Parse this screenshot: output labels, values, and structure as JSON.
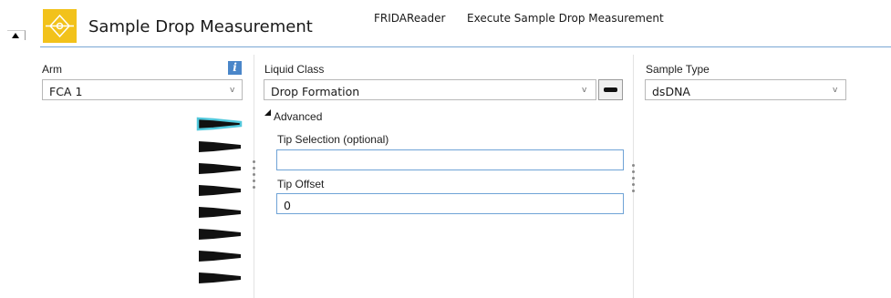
{
  "header": {
    "title": "Sample Drop Measurement",
    "app_name": "FRIDAReader",
    "action": "Execute Sample Drop Measurement",
    "icon": "drop-target-icon",
    "accent_color": "#f2c21b"
  },
  "arm": {
    "label": "Arm",
    "value": "FCA 1",
    "info_icon_label": "i",
    "tips_count": 8,
    "selected_tip_index": 0,
    "selected_tip_color": "#52c8dc"
  },
  "liquid_class": {
    "label": "Liquid Class",
    "value": "Drop Formation",
    "advanced_label": "Advanced",
    "tip_selection_label": "Tip Selection (optional)",
    "tip_selection_value": "",
    "tip_offset_label": "Tip Offset",
    "tip_offset_value": "0"
  },
  "sample_type": {
    "label": "Sample Type",
    "value": "dsDNA"
  },
  "chevron": "v"
}
